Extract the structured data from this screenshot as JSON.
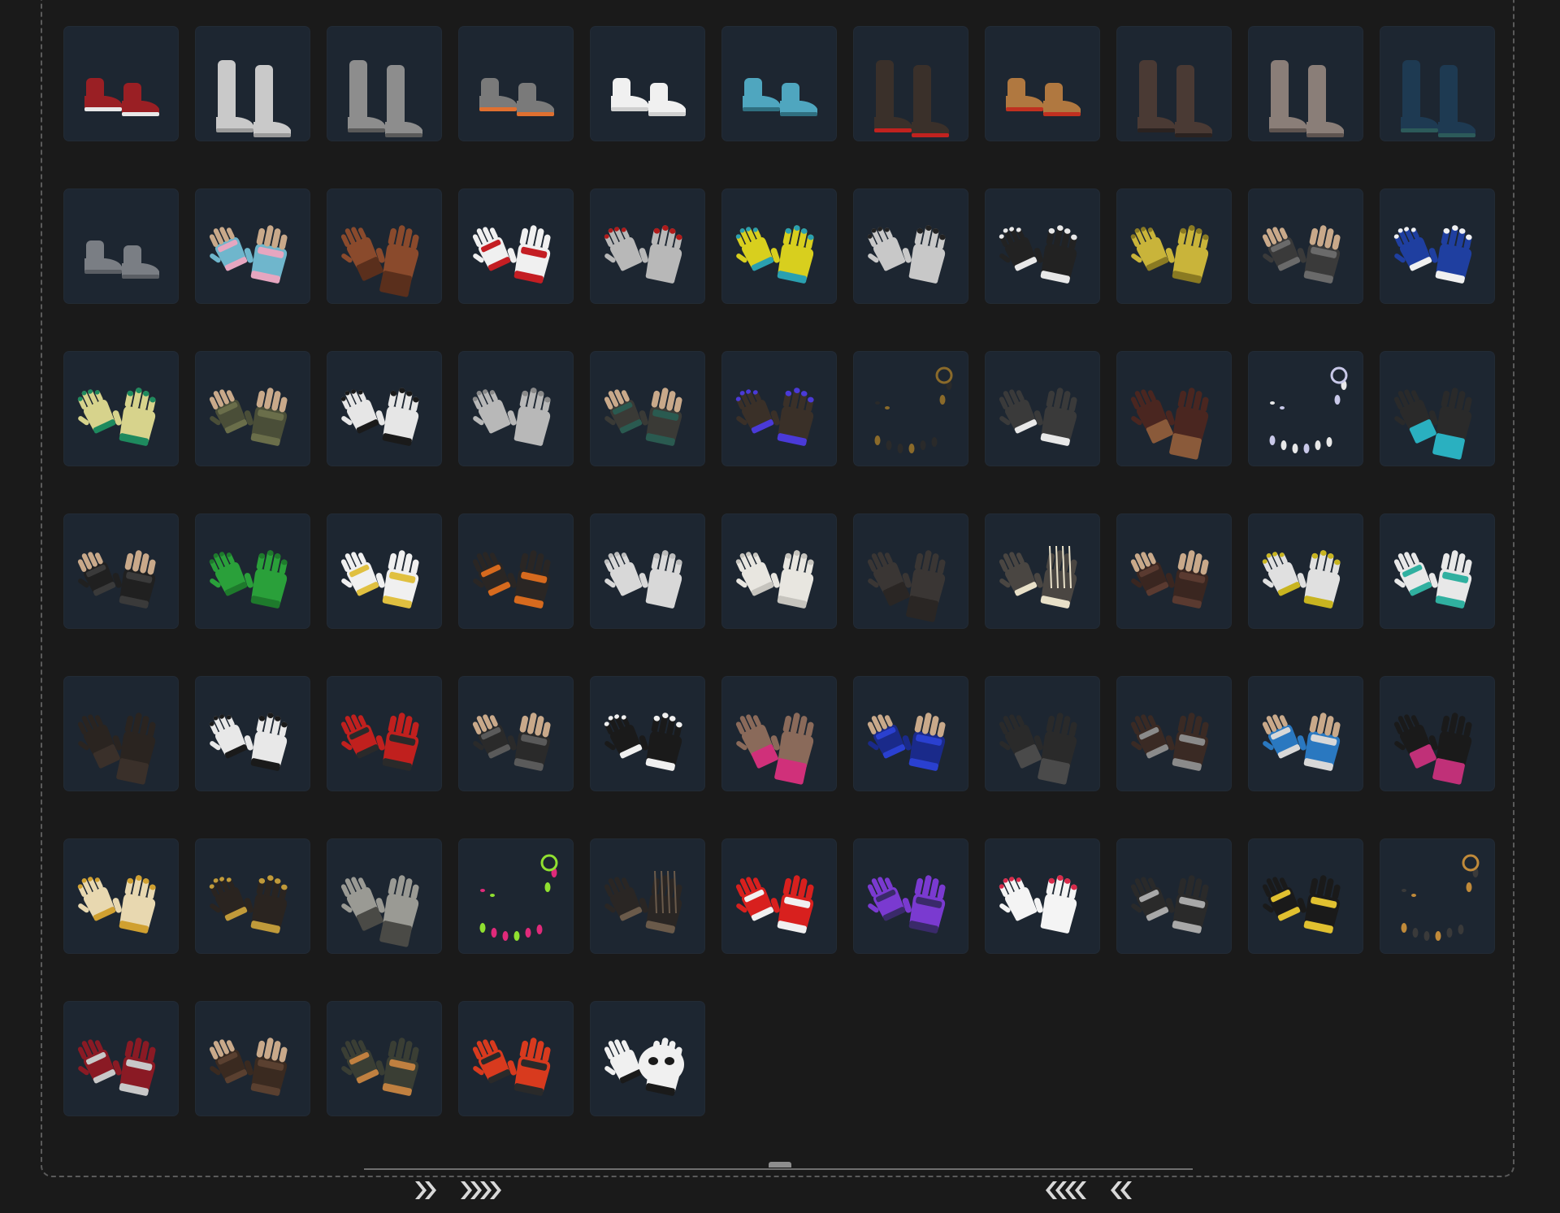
{
  "colors": {
    "background": "#1a1a1a",
    "tile": "#1d2631",
    "frame_dash": "#5a5a5a",
    "chevron": "#d8d8d8"
  },
  "items": [
    {
      "kind": "shoes",
      "style": "sneaker",
      "colors": [
        "#9a1f24",
        "#e8e8e8"
      ]
    },
    {
      "kind": "boots",
      "style": "tall",
      "colors": [
        "#c9c9c9",
        "#9a9a9a"
      ]
    },
    {
      "kind": "boots",
      "style": "fur",
      "colors": [
        "#8d8d8d",
        "#5a5a5a"
      ]
    },
    {
      "kind": "shoes",
      "style": "sneaker",
      "colors": [
        "#7a7a7a",
        "#e07030"
      ]
    },
    {
      "kind": "shoes",
      "style": "sneaker",
      "colors": [
        "#f0f0f0",
        "#cfcfcf"
      ]
    },
    {
      "kind": "shoes",
      "style": "claw",
      "colors": [
        "#4fa6bf",
        "#2f6f80"
      ]
    },
    {
      "kind": "boots",
      "style": "tall",
      "colors": [
        "#3a302a",
        "#c0221f"
      ]
    },
    {
      "kind": "boots",
      "style": "ankle",
      "colors": [
        "#b07840",
        "#c03020"
      ]
    },
    {
      "kind": "boots",
      "style": "tall",
      "colors": [
        "#4a3a34",
        "#2a2220"
      ]
    },
    {
      "kind": "boots",
      "style": "tall",
      "colors": [
        "#8a7e78",
        "#5e5450"
      ]
    },
    {
      "kind": "boots",
      "style": "tall",
      "colors": [
        "#1e3a52",
        "#2c5a5a"
      ]
    },
    {
      "kind": "shoes",
      "style": "boot",
      "colors": [
        "#7a7e84",
        "#5a5e64"
      ]
    },
    {
      "kind": "gloves",
      "style": "fingerless",
      "colors": [
        "#6fb6cc",
        "#e6a6c0"
      ]
    },
    {
      "kind": "gloves",
      "style": "gauntlet",
      "colors": [
        "#8a4a2c",
        "#5a2f1c"
      ]
    },
    {
      "kind": "gloves",
      "style": "moto",
      "colors": [
        "#f0f0f0",
        "#c41e23"
      ]
    },
    {
      "kind": "gloves",
      "style": "bare",
      "colors": [
        "#b8b8b8",
        "#b01a1a"
      ]
    },
    {
      "kind": "gloves",
      "style": "claw",
      "colors": [
        "#d8cf1e",
        "#2aa0b0"
      ]
    },
    {
      "kind": "gloves",
      "style": "bare",
      "colors": [
        "#c8c8c8",
        "#222222"
      ]
    },
    {
      "kind": "gloves",
      "style": "sport",
      "colors": [
        "#222222",
        "#e8e8e8"
      ]
    },
    {
      "kind": "gloves",
      "style": "work",
      "colors": [
        "#c9b43a",
        "#8a7a22"
      ]
    },
    {
      "kind": "gloves",
      "style": "fingerless",
      "colors": [
        "#3a3a3a",
        "#6a6a6a"
      ]
    },
    {
      "kind": "gloves",
      "style": "sport",
      "colors": [
        "#1f3fa0",
        "#f0f0f0"
      ]
    },
    {
      "kind": "gloves",
      "style": "work",
      "colors": [
        "#d7d38c",
        "#1e8a5e"
      ]
    },
    {
      "kind": "gloves",
      "style": "fingerless",
      "colors": [
        "#4a4e38",
        "#6a6e4a"
      ]
    },
    {
      "kind": "gloves",
      "style": "sport",
      "colors": [
        "#e6e6e6",
        "#1a1a1a"
      ]
    },
    {
      "kind": "gloves",
      "style": "bare",
      "colors": [
        "#b8b8b8",
        "#8a8a8a"
      ]
    },
    {
      "kind": "gloves",
      "style": "fingerless",
      "colors": [
        "#3a3a36",
        "#2a5a50"
      ]
    },
    {
      "kind": "gloves",
      "style": "claw",
      "colors": [
        "#3a3028",
        "#4a3ad8"
      ]
    },
    {
      "kind": "accessory",
      "style": "nails",
      "colors": [
        "#2a2a2a",
        "#8a6a2a"
      ]
    },
    {
      "kind": "gloves",
      "style": "lace",
      "colors": [
        "#3a3a3a",
        "#e8e8e8"
      ]
    },
    {
      "kind": "gloves",
      "style": "gauntlet",
      "colors": [
        "#4a2620",
        "#8a5a3a"
      ]
    },
    {
      "kind": "accessory",
      "style": "nails",
      "colors": [
        "#e8e8e8",
        "#c8c8e8"
      ]
    },
    {
      "kind": "gloves",
      "style": "long",
      "colors": [
        "#2a2a2a",
        "#2ab0c0"
      ]
    },
    {
      "kind": "gloves",
      "style": "fingerless",
      "colors": [
        "#202020",
        "#3a3a3a"
      ]
    },
    {
      "kind": "gloves",
      "style": "work",
      "colors": [
        "#2aa03a",
        "#1e7a2c"
      ]
    },
    {
      "kind": "gloves",
      "style": "moto",
      "colors": [
        "#f0f0f0",
        "#e0c040"
      ]
    },
    {
      "kind": "gloves",
      "style": "moto",
      "colors": [
        "#2a2624",
        "#d66a1e"
      ]
    },
    {
      "kind": "gloves",
      "style": "bare",
      "colors": [
        "#d8d8d8",
        "#bcbcbc"
      ]
    },
    {
      "kind": "gloves",
      "style": "work",
      "colors": [
        "#e8e6e0",
        "#c6c4be"
      ]
    },
    {
      "kind": "gloves",
      "style": "wrap",
      "colors": [
        "#3a3634",
        "#2a2624"
      ]
    },
    {
      "kind": "gloves",
      "style": "skeleton",
      "colors": [
        "#4a4642",
        "#e8e0c8"
      ]
    },
    {
      "kind": "gloves",
      "style": "fingerless",
      "colors": [
        "#3a2620",
        "#5a3a30"
      ]
    },
    {
      "kind": "gloves",
      "style": "work",
      "colors": [
        "#e0e0e0",
        "#c8b420"
      ]
    },
    {
      "kind": "gloves",
      "style": "moto",
      "colors": [
        "#e8e8e8",
        "#30b0a0"
      ]
    },
    {
      "kind": "gloves",
      "style": "long",
      "colors": [
        "#2a2420",
        "#3a302a"
      ]
    },
    {
      "kind": "gloves",
      "style": "sport",
      "colors": [
        "#e8e8e8",
        "#1a1a1a"
      ]
    },
    {
      "kind": "gloves",
      "style": "moto",
      "colors": [
        "#c0201e",
        "#2a2a2a"
      ]
    },
    {
      "kind": "gloves",
      "style": "fingerless",
      "colors": [
        "#2a2a2a",
        "#5a5a5a"
      ]
    },
    {
      "kind": "gloves",
      "style": "sport",
      "colors": [
        "#1a1a1a",
        "#f0f0f0"
      ]
    },
    {
      "kind": "gloves",
      "style": "wrap",
      "colors": [
        "#8a6a5a",
        "#d0307a"
      ]
    },
    {
      "kind": "gloves",
      "style": "fingerless",
      "colors": [
        "#1a2a8a",
        "#2a40d0"
      ]
    },
    {
      "kind": "gloves",
      "style": "long",
      "colors": [
        "#2a2a2a",
        "#4a4a4a"
      ]
    },
    {
      "kind": "gloves",
      "style": "moto",
      "colors": [
        "#3a2a24",
        "#8a8a8a"
      ]
    },
    {
      "kind": "gloves",
      "style": "fingerless",
      "colors": [
        "#2a78c0",
        "#d8d8d8"
      ]
    },
    {
      "kind": "gloves",
      "style": "long",
      "colors": [
        "#1a1a1a",
        "#c03078"
      ]
    },
    {
      "kind": "gloves",
      "style": "work",
      "colors": [
        "#e8d8b0",
        "#d0a030"
      ]
    },
    {
      "kind": "gloves",
      "style": "claw",
      "colors": [
        "#2a2420",
        "#c09a3a"
      ]
    },
    {
      "kind": "gloves",
      "style": "wrap",
      "colors": [
        "#9a9a94",
        "#4a4a46"
      ]
    },
    {
      "kind": "accessory",
      "style": "nails",
      "colors": [
        "#e02a7a",
        "#90e030"
      ]
    },
    {
      "kind": "gloves",
      "style": "skeleton",
      "colors": [
        "#2a2624",
        "#6a5a4a"
      ]
    },
    {
      "kind": "gloves",
      "style": "moto",
      "colors": [
        "#d8201e",
        "#f0f0f0"
      ]
    },
    {
      "kind": "gloves",
      "style": "moto",
      "colors": [
        "#7a3ad0",
        "#3a2a6a"
      ]
    },
    {
      "kind": "gloves",
      "style": "bare",
      "colors": [
        "#f4f4f4",
        "#d82a4a"
      ]
    },
    {
      "kind": "gloves",
      "style": "moto",
      "colors": [
        "#2a2a2a",
        "#a8a8a8"
      ]
    },
    {
      "kind": "gloves",
      "style": "moto",
      "colors": [
        "#1a1a1a",
        "#e0c030"
      ]
    },
    {
      "kind": "accessory",
      "style": "nails",
      "colors": [
        "#3a3a3a",
        "#c08a3a"
      ]
    },
    {
      "kind": "gloves",
      "style": "moto",
      "colors": [
        "#8a1a24",
        "#c8c8c8"
      ]
    },
    {
      "kind": "gloves",
      "style": "fingerless",
      "colors": [
        "#3a2a20",
        "#5a4030"
      ]
    },
    {
      "kind": "gloves",
      "style": "moto",
      "colors": [
        "#3a3e34",
        "#c08040"
      ]
    },
    {
      "kind": "gloves",
      "style": "moto",
      "colors": [
        "#d83a1e",
        "#2a2a2a"
      ]
    },
    {
      "kind": "gloves",
      "style": "mitten",
      "colors": [
        "#f0f0f0",
        "#1a1a1a"
      ]
    }
  ]
}
